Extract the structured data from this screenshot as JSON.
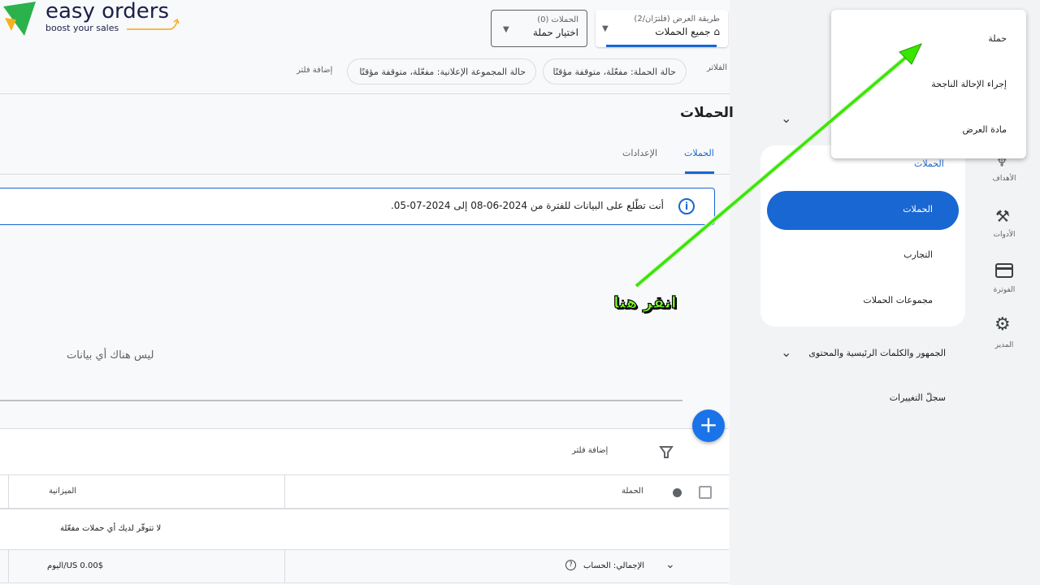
{
  "logo": {
    "brand": "easy orders",
    "tagline": "boost your sales"
  },
  "header": {
    "view_mode": {
      "label": "طريقة العرض (فلترَان/2)",
      "value": "جميع الحملات",
      "icon": "home-icon"
    },
    "campaign_picker": {
      "label": "الحملات (0)",
      "value": "اختيار حملة"
    }
  },
  "filters": {
    "label": "الفلاتر",
    "chips": [
      "حالة الحملة: مفعّلة، متوقفة مؤقتًا",
      "حالة المجموعة الإعلانية: مفعّلة، متوقفة مؤقتًا"
    ],
    "add_filter": "إضافة فلتر"
  },
  "page": {
    "title": "الحملات",
    "tabs": [
      {
        "label": "الحملات",
        "active": true
      },
      {
        "label": "الإعدادات",
        "active": false
      }
    ]
  },
  "info_banner": {
    "text": "أنت تطّلع على البيانات للفترة من 2024-06-08 إلى 2024-07-05."
  },
  "chart": {
    "empty_text": "ليس هناك أي بيانات"
  },
  "table": {
    "add_filter": "إضافة فلتر",
    "columns": [
      "الحملة",
      "الميزانية"
    ],
    "empty_text": "لا تتوفّر لديك أي حملات مفعّلة",
    "total": {
      "label": "الإجمالي: الحساب",
      "budget": "$US 0.00/اليوم"
    }
  },
  "sidebar": {
    "section": "الحملات",
    "items": [
      "الحملات",
      "التجارب",
      "مجموعات الحملات"
    ],
    "audience": "الجمهور والكلمات الرئيسية والمحتوى",
    "change_history": "سجلّ التغييرات"
  },
  "rail": [
    {
      "label": "الأهداف",
      "icon": "goals-icon"
    },
    {
      "label": "الأدوات",
      "icon": "tools-icon"
    },
    {
      "label": "الفوترة",
      "icon": "billing-icon"
    },
    {
      "label": "المدير",
      "icon": "admin-icon"
    }
  ],
  "menu": {
    "items": [
      "حملة",
      "إجراء الإحالة الناجحة",
      "مادة العرض"
    ]
  },
  "annotation": {
    "text": "انقر هنا",
    "color": "#39e600"
  },
  "colors": {
    "accent": "#1967d2",
    "fab": "#1a73e8"
  }
}
